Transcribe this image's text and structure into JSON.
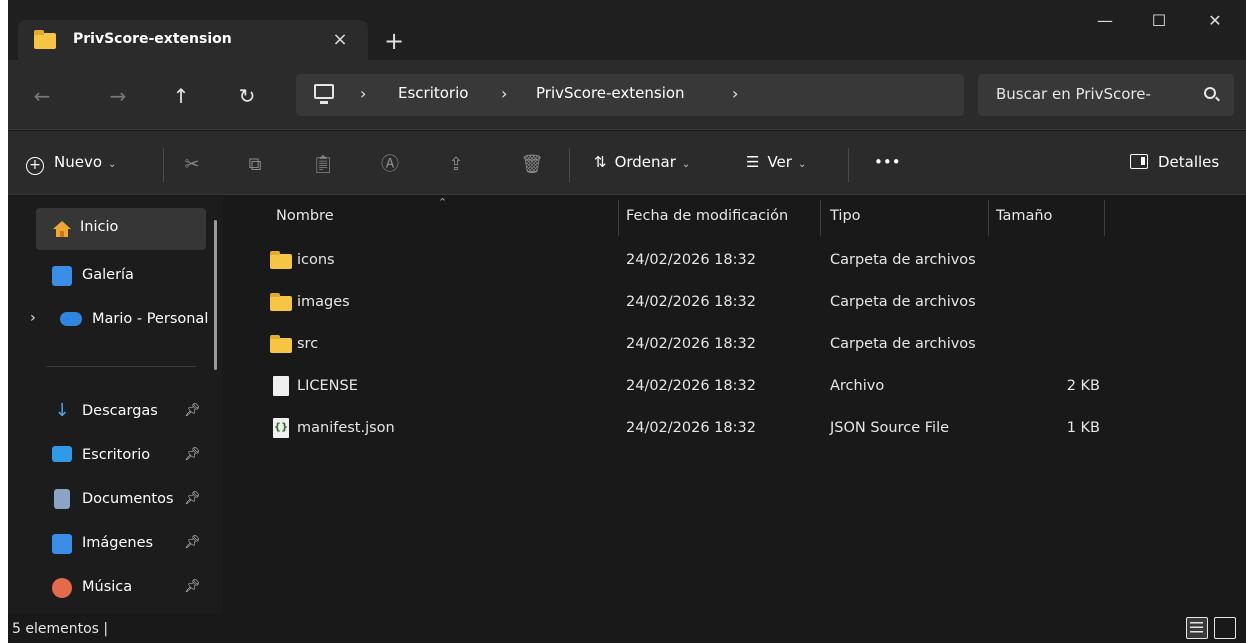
{
  "tab": {
    "title": "PrivScore-extension",
    "close_label": "×",
    "new_tab_label": "+"
  },
  "window_controls": {
    "minimize": "—",
    "maximize": "☐",
    "close": "✕"
  },
  "nav": {
    "back": "←",
    "forward": "→",
    "up": "↑",
    "refresh": "↻"
  },
  "breadcrumb": {
    "sep": "›",
    "items": [
      "Escritorio",
      "PrivScore-extension"
    ]
  },
  "search": {
    "placeholder": "Buscar en PrivScore-"
  },
  "toolbar": {
    "new_label": "Nuevo",
    "sort_label": "Ordenar",
    "view_label": "Ver",
    "more_label": "•••",
    "details_label": "Detalles"
  },
  "sidebar": {
    "items": [
      {
        "label": "Inicio",
        "icon": "home-icon"
      },
      {
        "label": "Galería",
        "icon": "gallery-icon"
      },
      {
        "label": "Mario - Personal",
        "icon": "onedrive-icon"
      },
      {
        "label": "Descargas",
        "icon": "download-icon"
      },
      {
        "label": "Escritorio",
        "icon": "desktop-icon"
      },
      {
        "label": "Documentos",
        "icon": "documents-icon"
      },
      {
        "label": "Imágenes",
        "icon": "pictures-icon"
      },
      {
        "label": "Música",
        "icon": "music-icon"
      }
    ]
  },
  "columns": {
    "name": "Nombre",
    "modified": "Fecha de modificación",
    "type": "Tipo",
    "size": "Tamaño"
  },
  "files": [
    {
      "name": "icons",
      "modified": "24/02/2026 18:32",
      "type": "Carpeta de archivos",
      "size": "",
      "icon": "folder-icon"
    },
    {
      "name": "images",
      "modified": "24/02/2026 18:32",
      "type": "Carpeta de archivos",
      "size": "",
      "icon": "folder-icon"
    },
    {
      "name": "src",
      "modified": "24/02/2026 18:32",
      "type": "Carpeta de archivos",
      "size": "",
      "icon": "folder-icon"
    },
    {
      "name": "LICENSE",
      "modified": "24/02/2026 18:32",
      "type": "Archivo",
      "size": "2 KB",
      "icon": "file-icon"
    },
    {
      "name": "manifest.json",
      "modified": "24/02/2026 18:32",
      "type": "JSON Source File",
      "size": "1 KB",
      "icon": "json-file-icon"
    }
  ],
  "status": {
    "text": "5 elementos  |"
  },
  "colors": {
    "folder": "#f5c543",
    "background": "#191919",
    "toolbar": "#2b2b2b",
    "selected": "#363636"
  }
}
